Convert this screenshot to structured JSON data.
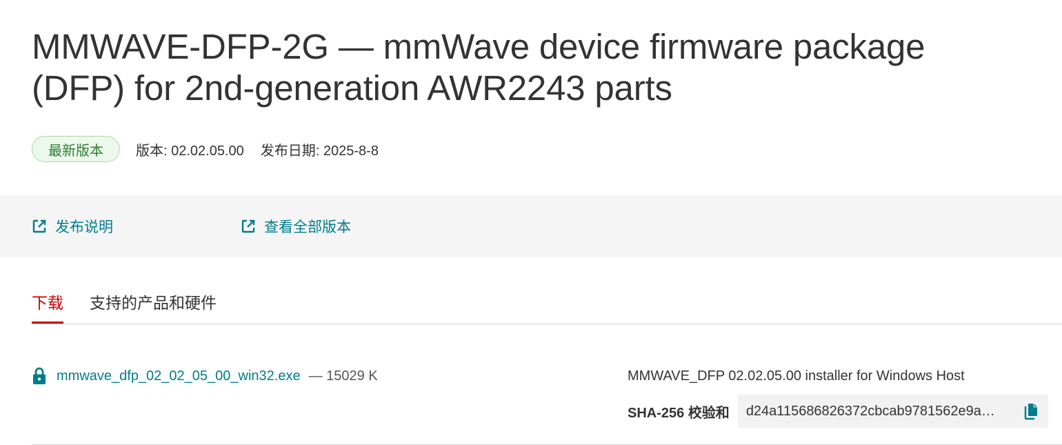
{
  "header": {
    "title": "MMWAVE-DFP-2G — mmWave device firmware package (DFP) for 2nd-generation AWR2243 parts",
    "badge": "最新版本",
    "version": "版本: 02.02.05.00",
    "release_date": "发布日期: 2025-8-8"
  },
  "links": {
    "release_notes": "发布说明",
    "all_versions": "查看全部版本",
    "icon": "external-link-icon"
  },
  "tabs": [
    {
      "label": "下载",
      "active": true
    },
    {
      "label": "支持的产品和硬件",
      "active": false
    }
  ],
  "downloads": [
    {
      "filename": "mmwave_dfp_02_02_05_00_win32.exe",
      "size": "— 15029 K",
      "description": "MMWAVE_DFP 02.02.05.00 installer for Windows Host",
      "checksum_label": "SHA-256 校验和",
      "checksum": "d24a115686826372cbcab9781562e9a…",
      "lock_icon": "lock-icon",
      "copy_icon": "copy-icon"
    }
  ],
  "colors": {
    "link": "#007c8c",
    "active_tab": "#cc0000",
    "badge_text": "#2e7d32",
    "badge_bg": "#ecf8ec",
    "band_bg": "#f5f5f5"
  }
}
